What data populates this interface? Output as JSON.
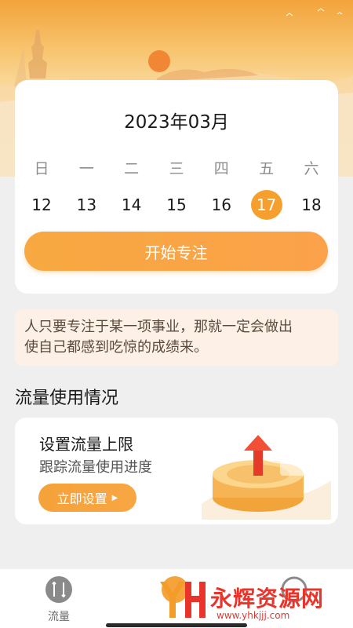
{
  "calendar": {
    "title": "2023年03月",
    "weekdays": [
      "日",
      "一",
      "二",
      "三",
      "四",
      "五",
      "六"
    ],
    "dates": [
      "12",
      "13",
      "14",
      "15",
      "16",
      "17",
      "18"
    ],
    "selected_date": "17",
    "focus_button": "开始专注"
  },
  "quote": {
    "line1": "人只要专注于某一项事业，那就一定会做出",
    "line2": "使自己都感到吃惊的成绩来。"
  },
  "traffic": {
    "section_title": "流量使用情况",
    "card_title": "设置流量上限",
    "card_subtitle": "跟踪流量使用进度",
    "set_button": "立即设置"
  },
  "nav": {
    "items": [
      {
        "label": "流量",
        "icon": "traffic-icon"
      },
      {
        "label": "",
        "icon": "focus-icon"
      },
      {
        "label": "",
        "icon": "settings-icon"
      }
    ]
  },
  "watermark": {
    "text": "永辉资源网",
    "url": "www.yhkjjj.com"
  },
  "colors": {
    "accent": "#f5a02e",
    "background": "#efefef",
    "quote_bg": "#fdf1e7"
  }
}
